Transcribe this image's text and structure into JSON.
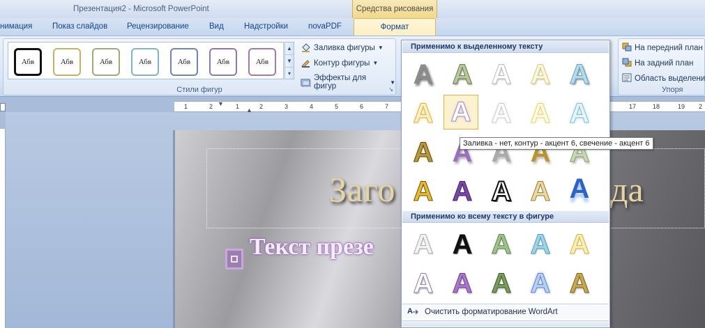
{
  "window": {
    "title": "Презентация2 - Microsoft PowerPoint",
    "context_tab_group": "Средства рисования"
  },
  "tabs": [
    {
      "label": "нимация"
    },
    {
      "label": "Показ слайдов"
    },
    {
      "label": "Рецензирование"
    },
    {
      "label": "Вид"
    },
    {
      "label": "Надстройки"
    },
    {
      "label": "novaPDF"
    }
  ],
  "active_tab": "Формат",
  "ribbon": {
    "shape_styles_label": "Стили фигур",
    "swatch_text": "Абв",
    "swatch_colors": [
      "#111111",
      "#c8b067",
      "#9faa78",
      "#7ab8c7",
      "#6c86b9",
      "#8f76b5",
      "#a27aa7"
    ],
    "fill_cmd": "Заливка фигуры",
    "outline_cmd": "Контур фигуры",
    "effects_cmd": "Эффекты для фигур",
    "bring_front": "На передний план",
    "send_back": "На задний план",
    "selection_pane": "Область выделени",
    "arrange_label": "Упоря"
  },
  "ruler": {
    "ticks": [
      "1",
      "2",
      "1",
      "2",
      "3",
      "4",
      "5",
      "6",
      "7",
      "17",
      "18",
      "19",
      "2"
    ]
  },
  "slide": {
    "title_left": "Заго",
    "title_right": "да",
    "body_text": "Текст презе"
  },
  "wordart_menu": {
    "section1": "Применимо к выделенному тексту",
    "section2": "Применимо ко всему тексту в фигуре",
    "glyph": "A",
    "tooltip": "Заливка - нет, контур - акцент 6, свечение - акцент 6",
    "clear": "Очистить форматирование WordArt"
  }
}
